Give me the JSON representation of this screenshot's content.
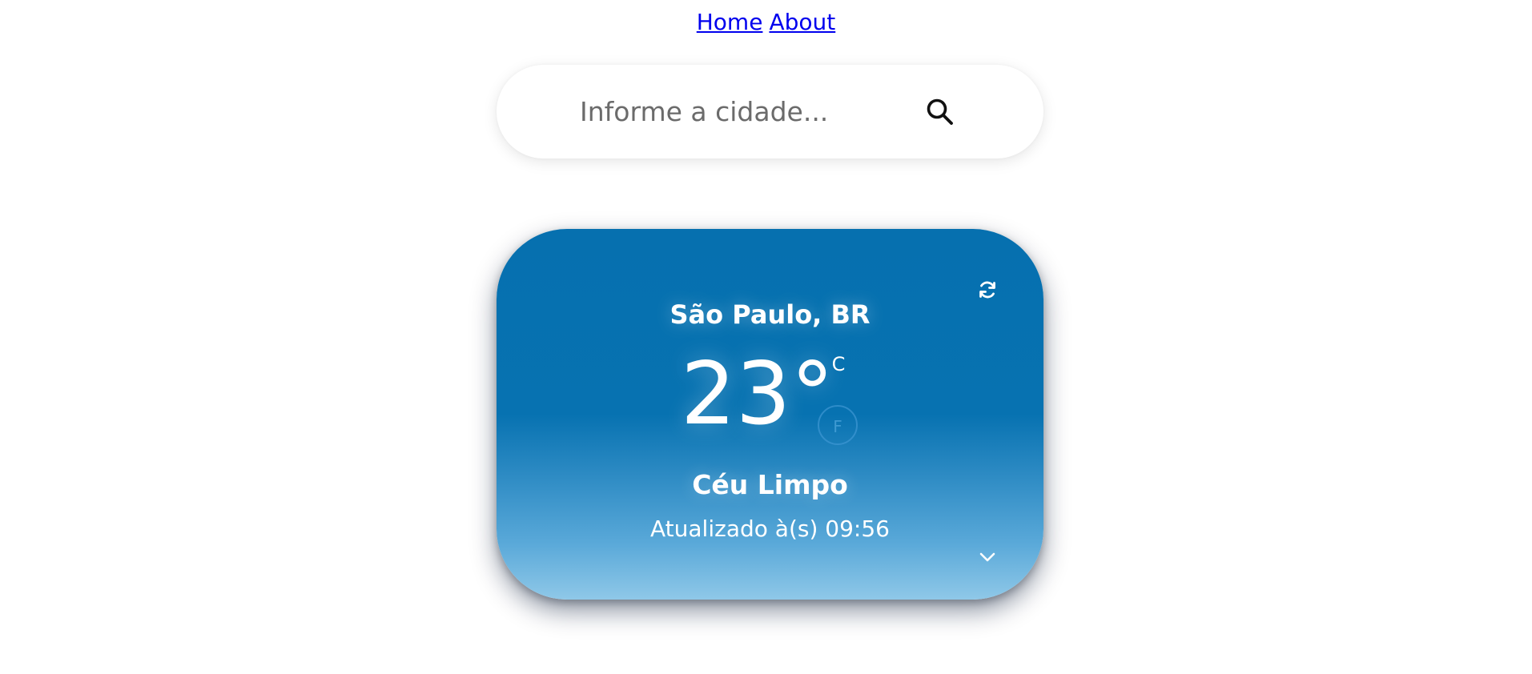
{
  "nav": {
    "links": [
      {
        "label": "Home"
      },
      {
        "label": "About"
      }
    ]
  },
  "search": {
    "placeholder": "Informe a cidade...",
    "value": "",
    "icon": "search-icon"
  },
  "weather": {
    "location": "São Paulo, BR",
    "temperature": "23°",
    "unit_c": "C",
    "unit_f": "F",
    "active_unit": "C",
    "condition": "Céu Limpo",
    "updated": "Atualizado à(s) 09:56",
    "refresh_icon": "refresh-icon",
    "expand_icon": "chevron-down-icon"
  },
  "colors": {
    "card_top": "#0670af",
    "card_bottom": "#8fc8e8",
    "link": "#0000ee",
    "text_on_card": "#ffffff"
  }
}
